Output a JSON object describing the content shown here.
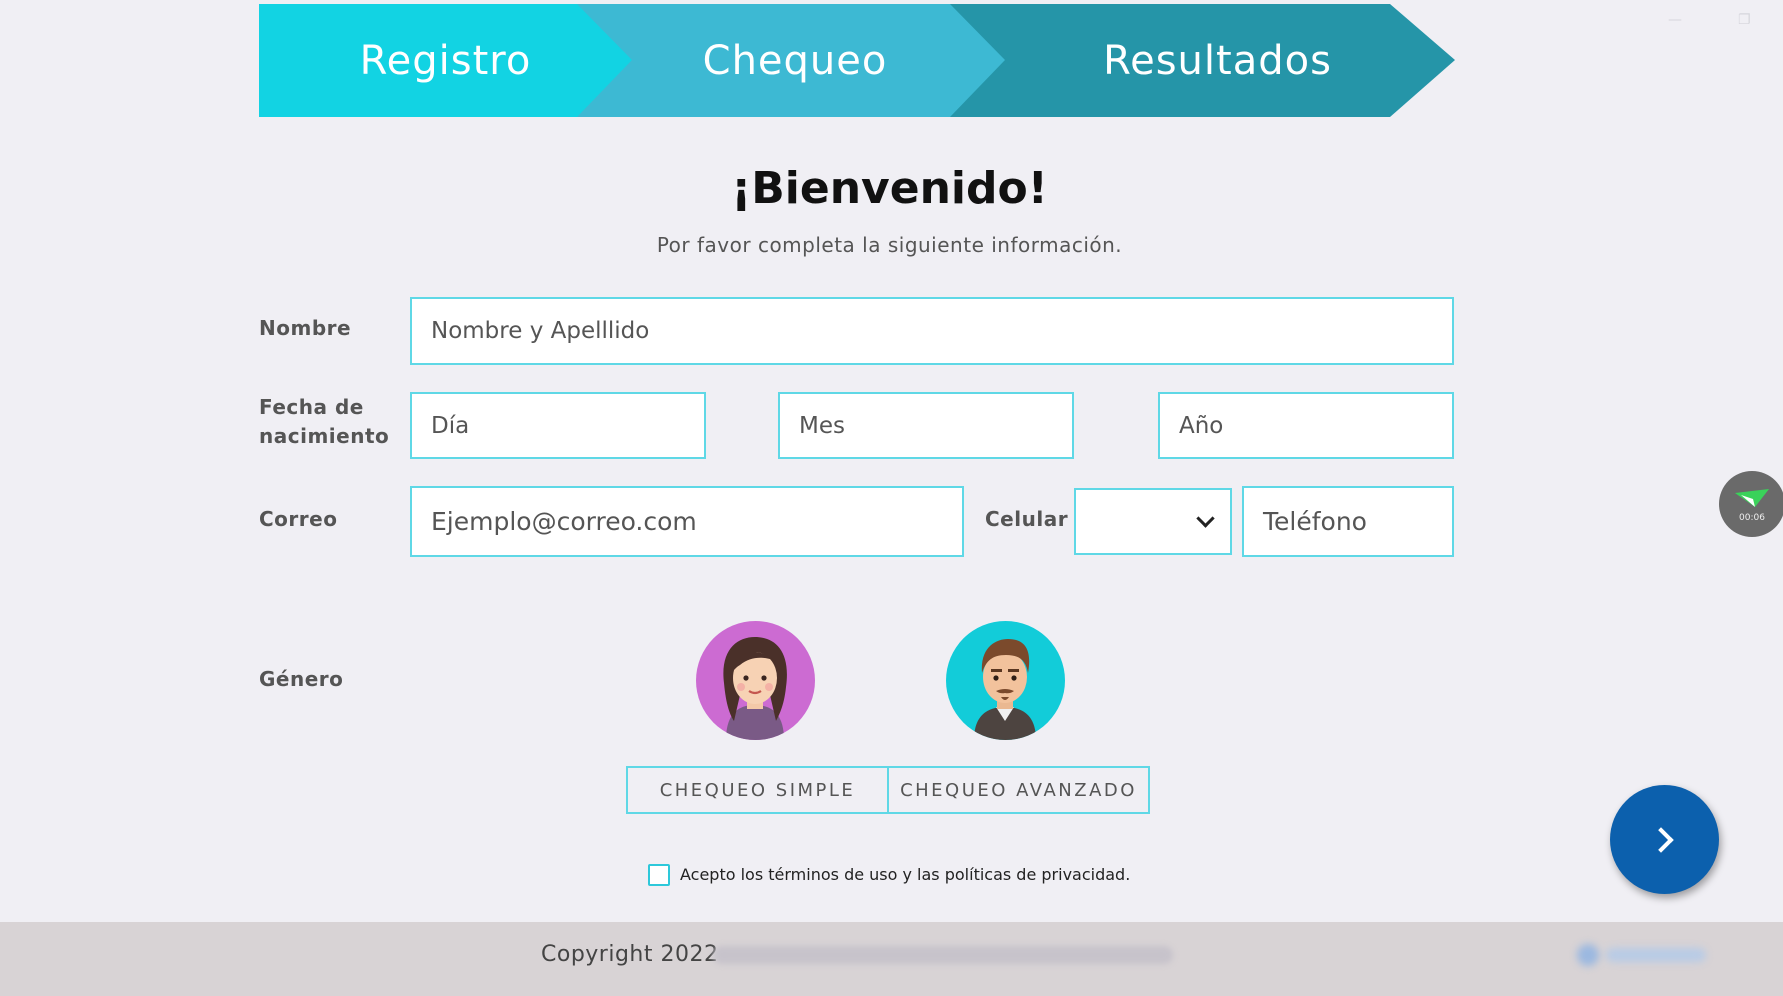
{
  "stepper": {
    "steps": [
      {
        "label": "Registro"
      },
      {
        "label": "Chequeo"
      },
      {
        "label": "Resultados"
      }
    ],
    "colors": [
      "#12d3e3",
      "#3db9d3",
      "#2595a8"
    ]
  },
  "header": {
    "title": "¡Bienvenido!",
    "subtitle": "Por favor completa la siguiente información."
  },
  "form": {
    "nombre": {
      "label": "Nombre",
      "placeholder": "Nombre y Apelllido"
    },
    "fecha": {
      "label_line1": "Fecha de",
      "label_line2": "nacimiento",
      "dia_placeholder": "Día",
      "mes_placeholder": "Mes",
      "anio_placeholder": "Año"
    },
    "correo": {
      "label": "Correo",
      "placeholder": "Ejemplo@correo.com"
    },
    "celular": {
      "label": "Celular",
      "code_value": "",
      "phone_placeholder": "Teléfono"
    },
    "genero": {
      "label": "Género",
      "options": [
        "female-avatar",
        "male-avatar"
      ]
    },
    "chequeo": {
      "simple_label": "CHEQUEO SIMPLE",
      "avanzado_label": "CHEQUEO AVANZADO"
    },
    "terms": {
      "label": "Acepto los términos de uso y las políticas de privacidad.",
      "checked": false
    }
  },
  "recorder": {
    "time": "00:06"
  },
  "footer": {
    "copyright": "Copyright 2022"
  },
  "colors": {
    "accent": "#5fd8e6",
    "fab": "#0c60ad",
    "footer_bg": "#d8d3d5"
  }
}
